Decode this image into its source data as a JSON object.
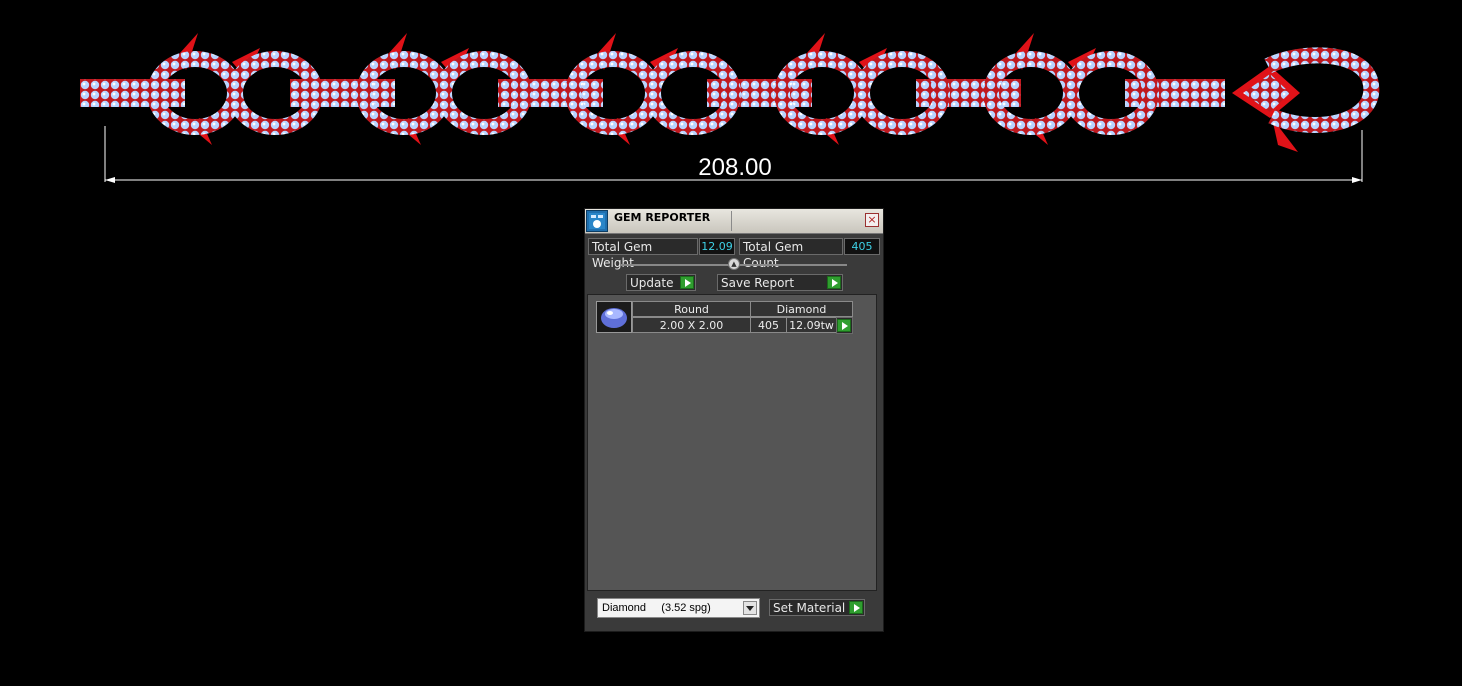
{
  "viewport": {
    "dimension_value": "208.00",
    "colors": {
      "metal": "#e0121a",
      "gem": "#b9d3ff"
    }
  },
  "gem_reporter": {
    "title": "GEM REPORTER",
    "close_symbol": "×",
    "total_gem_weight_label": "Total Gem Weight",
    "total_gem_weight_value": "12.09",
    "total_gem_count_label": "Total Gem Count",
    "total_gem_count_value": "405",
    "update_label": "Update",
    "save_report_label": "Save Report",
    "gem_rows": [
      {
        "shape": "Round",
        "material": "Diamond",
        "size": "2.00 X 2.00",
        "count": "405",
        "weight": "12.09tw"
      }
    ],
    "material_select_value": "Diamond     (3.52 spg)",
    "set_material_label": "Set Material",
    "colors": {
      "value_text": "#3ed1e6",
      "go_button": "#2f9e2f",
      "panel_bg": "#3a3a3a"
    }
  }
}
